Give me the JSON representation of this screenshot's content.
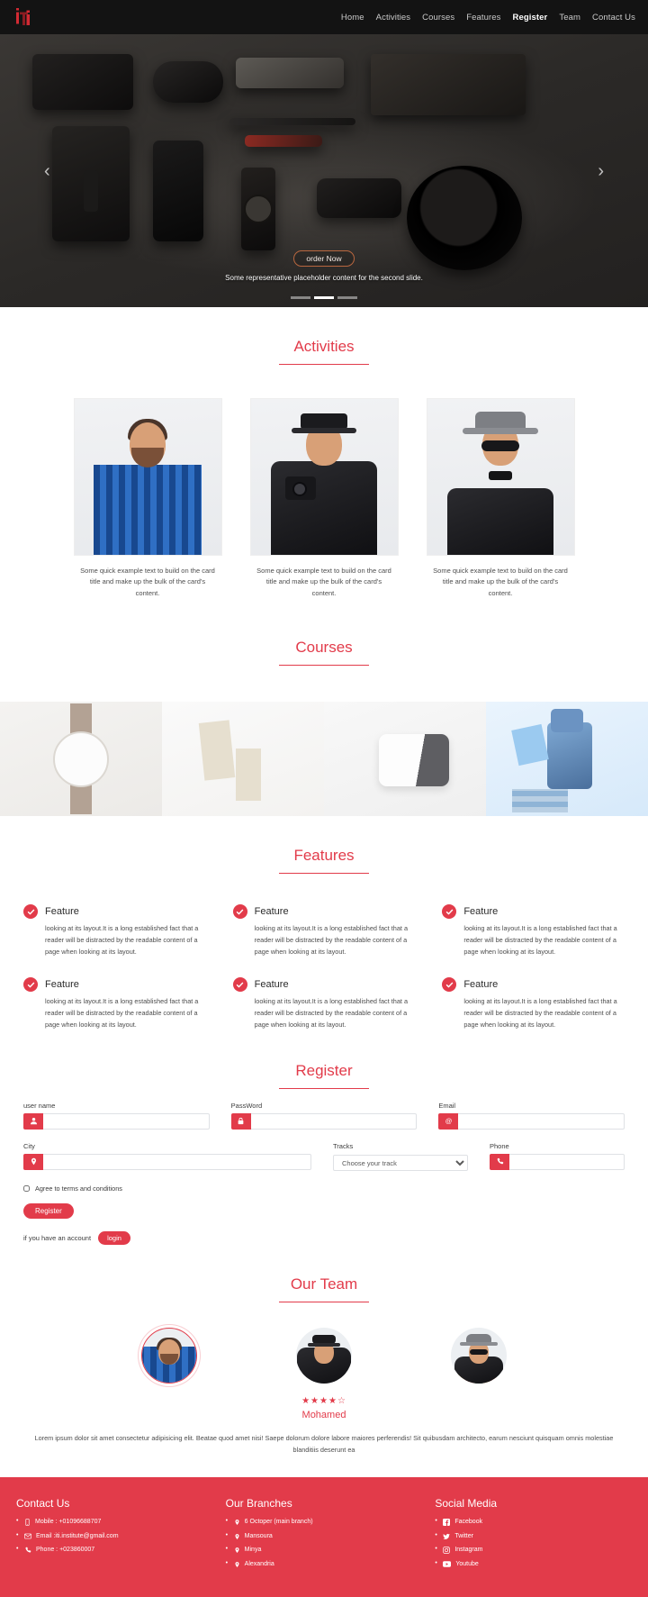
{
  "brand": {
    "logo_text": "iTi",
    "accent_color": "#e23b4a",
    "nav_bg": "#131313"
  },
  "nav": {
    "items": [
      {
        "label": "Home",
        "active": false
      },
      {
        "label": "Activities",
        "active": false
      },
      {
        "label": "Courses",
        "active": false
      },
      {
        "label": "Features",
        "active": false
      },
      {
        "label": "Register",
        "active": true
      },
      {
        "label": "Team",
        "active": false
      },
      {
        "label": "Contact Us",
        "active": false
      }
    ]
  },
  "carousel": {
    "order_button": "order Now",
    "caption": "Some representative placeholder content for the second slide.",
    "prev_arrow": "‹",
    "next_arrow": "›",
    "slide_count": 3,
    "active_slide": 2
  },
  "activities": {
    "title": "Activities",
    "cards": [
      {
        "text": "Some quick example text to build on the card title and make up the bulk of the card's content."
      },
      {
        "text": "Some quick example text to build on the card title and make up the bulk of the card's content."
      },
      {
        "text": "Some quick example text to build on the card title and make up the bulk of the card's content."
      }
    ]
  },
  "courses": {
    "title": "Courses",
    "images": [
      {
        "alt": "wristwatch"
      },
      {
        "alt": "stationery-cards"
      },
      {
        "alt": "white-device-box"
      },
      {
        "alt": "toy-robot-with-books"
      }
    ]
  },
  "features": {
    "title": "Features",
    "items": [
      {
        "title": "Feature",
        "body": "looking at its layout.It is a long established fact that a reader will be distracted by the readable content of a page when looking at its layout."
      },
      {
        "title": "Feature",
        "body": "looking at its layout.It is a long established fact that a reader will be distracted by the readable content of a page when looking at its layout."
      },
      {
        "title": "Feature",
        "body": "looking at its layout.It is a long established fact that a reader will be distracted by the readable content of a page when looking at its layout."
      },
      {
        "title": "Feature",
        "body": "looking at its layout.It is a long established fact that a reader will be distracted by the readable content of a page when looking at its layout."
      },
      {
        "title": "Feature",
        "body": "looking at its layout.It is a long established fact that a reader will be distracted by the readable content of a page when looking at its layout."
      },
      {
        "title": "Feature",
        "body": "looking at its layout.It is a long established fact that a reader will be distracted by the readable content of a page when looking at its layout."
      }
    ]
  },
  "register": {
    "title": "Register",
    "username": {
      "label": "user name",
      "value": "",
      "placeholder": "",
      "icon": "user-icon"
    },
    "password": {
      "label": "PassWord",
      "value": "",
      "placeholder": "",
      "icon": "lock-icon"
    },
    "email": {
      "label": "Email",
      "value": "",
      "placeholder": "",
      "icon": "at-icon"
    },
    "city": {
      "label": "City",
      "value": "",
      "placeholder": "",
      "icon": "map-marker-icon"
    },
    "tracks": {
      "label": "Tracks",
      "selected": "Choose your track",
      "options": [
        "Choose your track"
      ]
    },
    "phone": {
      "label": "Phone",
      "value": "",
      "placeholder": "",
      "icon": "phone-icon"
    },
    "terms_label": "Agree to terms and conditions",
    "terms_checked": false,
    "submit_label": "Register",
    "account_text": "if you have an account",
    "login_label": "login"
  },
  "team": {
    "title": "Our Team",
    "members": [
      {
        "name": "",
        "avatar": "bearded-man-plaid-shirt",
        "active": true
      },
      {
        "name": "Mohamed",
        "avatar": "woman-with-camera",
        "active": false
      },
      {
        "name": "",
        "avatar": "man-in-hat-with-flowers",
        "active": false
      }
    ],
    "rating_stars": "★★★★☆",
    "rating_value": 4,
    "rating_max": 5,
    "featured_name": "Mohamed",
    "description": "Lorem ipsum dolor sit amet consectetur adipisicing elit. Beatae quod amet nisi! Saepe dolorum dolore labore maiores perferendis! Sit quibusdam architecto, earum nesciunt quisquam omnis molestiae blanditiis deserunt ea"
  },
  "footer": {
    "contact": {
      "title": "Contact Us",
      "items": [
        {
          "icon": "mobile-icon",
          "text": "Mobile : +01096688707"
        },
        {
          "icon": "envelope-icon",
          "text": "Email :iti.institute@gmail.com"
        },
        {
          "icon": "phone-icon",
          "text": "Phone : +023860007"
        }
      ]
    },
    "branches": {
      "title": "Our Branches",
      "items": [
        {
          "icon": "map-marker-icon",
          "text": "6 Octoper (main branch)"
        },
        {
          "icon": "map-marker-icon",
          "text": "Mansoura"
        },
        {
          "icon": "map-marker-icon",
          "text": "Minya"
        },
        {
          "icon": "map-marker-icon",
          "text": "Alexandria"
        }
      ]
    },
    "social": {
      "title": "Social Media",
      "items": [
        {
          "icon": "facebook-icon",
          "text": "Facebook"
        },
        {
          "icon": "twitter-icon",
          "text": "Twitter"
        },
        {
          "icon": "instagram-icon",
          "text": "Instagram"
        },
        {
          "icon": "youtube-icon",
          "text": "Youtube"
        }
      ]
    }
  }
}
